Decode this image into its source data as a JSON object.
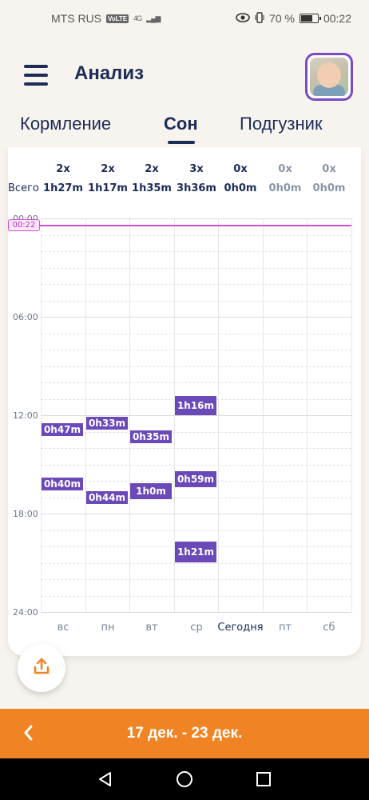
{
  "status_bar": {
    "carrier": "MTS RUS",
    "volte": "VoLTE",
    "network": "4G",
    "battery": "70 %",
    "time": "00:22"
  },
  "header": {
    "title": "Анализ"
  },
  "tabs": [
    "Кормление",
    "Сон",
    "Подгузник"
  ],
  "active_tab": "Сон",
  "summary": {
    "total_label": "Всего",
    "counts": [
      "2x",
      "2x",
      "2x",
      "3x",
      "0x",
      "0x",
      "0x"
    ],
    "totals": [
      "1h27m",
      "1h17m",
      "1h35m",
      "3h36m",
      "0h0m",
      "0h0m",
      "0h0m"
    ]
  },
  "chart": {
    "time_labels": [
      "00:00",
      "06:00",
      "12:00",
      "18:00",
      "24:00"
    ],
    "now_badge": "00:22",
    "days": [
      "вс",
      "пн",
      "вт",
      "ср",
      "Сегодня",
      "пт",
      "сб"
    ],
    "events": [
      {
        "day": 0,
        "label": "0h47m"
      },
      {
        "day": 0,
        "label": "0h40m"
      },
      {
        "day": 1,
        "label": "0h33m"
      },
      {
        "day": 1,
        "label": "0h44m"
      },
      {
        "day": 2,
        "label": "0h35m"
      },
      {
        "day": 2,
        "label": "1h0m"
      },
      {
        "day": 3,
        "label": "1h16m"
      },
      {
        "day": 3,
        "label": "0h59m"
      },
      {
        "day": 3,
        "label": "1h21m"
      }
    ]
  },
  "footer": {
    "range": "17 дек. - 23 дек."
  },
  "colors": {
    "accent_orange": "#f08424",
    "event_purple": "#6a49b8",
    "now_line": "#d84ad8",
    "primary": "#1d2b57"
  }
}
